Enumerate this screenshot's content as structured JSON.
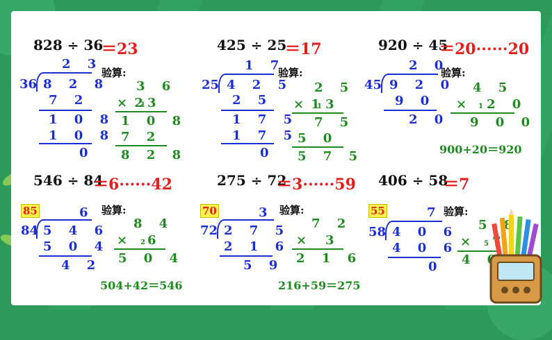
{
  "colors": {
    "answer": "#e0201e",
    "work": "#1b2fd0",
    "check": "#1f8a1f",
    "estimate_bg": "#fff24a"
  },
  "verify_label": "验算:",
  "problems": [
    {
      "expr": "828 ÷ 36",
      "answer": "＝23",
      "divisor": "36",
      "quotient": "2 3",
      "work": [
        "8 2 8",
        "7 2",
        "1 0 8",
        "1 0 8",
        "0"
      ],
      "check_top": "3 6",
      "check_mul": "× 2",
      "check_mul_sub": "1",
      "check_mul_end": "3",
      "check_rows": [
        "1 0 8",
        "7 2",
        "8 2 8"
      ]
    },
    {
      "expr": "425 ÷ 25",
      "answer": "＝17",
      "divisor": "25",
      "quotient": "1 7",
      "work": [
        "4 2 5",
        "2 5",
        "1 7 5",
        "1 7 5",
        "0"
      ],
      "check_top": "2 5",
      "check_mul": "× 1",
      "check_mul_sub": "1",
      "check_mul_end": "3",
      "check_rows": [
        "7 5",
        "5 0",
        "5 7 5"
      ]
    },
    {
      "expr": "920 ÷ 45",
      "answer": "＝20······20",
      "divisor": "45",
      "quotient": "2 0",
      "work": [
        "9 2 0",
        "9 0",
        "2 0"
      ],
      "check_top": "4 5",
      "check_mul": "×",
      "check_mul_sub": "1",
      "check_mul_end": "2 0",
      "check_rows": [
        "9 0 0"
      ],
      "check_eq": "900+20＝920"
    },
    {
      "expr": "546 ÷ 84",
      "answer": "＝6······42",
      "estimate": "85",
      "divisor": "84",
      "quotient": "6",
      "work": [
        "5 4 6",
        "5 0 4",
        "4 2"
      ],
      "check_top": "8 4",
      "check_mul": "×",
      "check_mul_sub": "2",
      "check_mul_end": "6",
      "check_rows": [
        "5 0 4"
      ],
      "check_eq": "504+42＝546"
    },
    {
      "expr": "275 ÷ 72",
      "answer": "＝3······59",
      "estimate": "70",
      "divisor": "72",
      "quotient": "3",
      "work": [
        "2 7 5",
        "2 1 6",
        "5 9"
      ],
      "check_top": "7 2",
      "check_mul": "×",
      "check_mul_sub": "",
      "check_mul_end": "3",
      "check_rows": [
        "2 1 6"
      ],
      "check_eq": "216+59＝275"
    },
    {
      "expr": "406 ÷ 58",
      "answer": "＝7",
      "estimate": "55",
      "divisor": "58",
      "quotient": "7",
      "work": [
        "4 0 6",
        "4 0 6",
        "0"
      ],
      "check_top": "5 8",
      "check_mul": "×",
      "check_mul_sub": "5",
      "check_mul_end": "7",
      "check_rows": [
        "4 0 6"
      ]
    }
  ]
}
